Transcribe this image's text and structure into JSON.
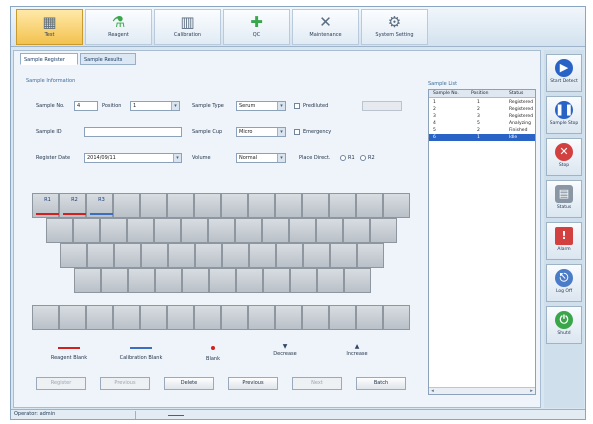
{
  "toolbar": {
    "items": [
      {
        "label": "Test",
        "icon": "test-icon",
        "active": true
      },
      {
        "label": "Reagent",
        "icon": "reagent-icon",
        "active": false
      },
      {
        "label": "Calibration",
        "icon": "calibration-icon",
        "active": false
      },
      {
        "label": "QC",
        "icon": "qc-icon",
        "active": false
      },
      {
        "label": "Maintenance",
        "icon": "maintenance-icon",
        "active": false
      },
      {
        "label": "System Setting",
        "icon": "system-setting-icon",
        "active": false
      }
    ]
  },
  "tabs": [
    {
      "label": "Sample Register",
      "active": true
    },
    {
      "label": "Sample Results",
      "active": false
    }
  ],
  "form": {
    "section_title": "Sample Information",
    "sample_no_label": "Sample No.",
    "sample_no_value": "4",
    "position_label": "Position",
    "position_value": "1",
    "sample_type_label": "Sample Type",
    "sample_type_value": "Serum",
    "prediluted_label": "Prediluted",
    "sample_id_label": "Sample ID",
    "sample_id_value": "",
    "sample_cup_label": "Sample Cup",
    "sample_cup_value": "Micro",
    "emergency_label": "Emergency",
    "register_date_label": "Register Date",
    "register_date_value": "2014/09/11",
    "volume_label": "Volume",
    "volume_value": "Normal",
    "place_direction_label": "Place Direct.",
    "place_direction_opt1": "R1",
    "place_direction_opt2": "R2"
  },
  "sample_list": {
    "title": "Sample List",
    "columns": [
      "Sample No.",
      "Position",
      "Status"
    ],
    "rows": [
      {
        "no": "1",
        "pos": "1",
        "status": "Registered",
        "selected": false
      },
      {
        "no": "2",
        "pos": "2",
        "status": "Registered",
        "selected": false
      },
      {
        "no": "3",
        "pos": "3",
        "status": "Registered",
        "selected": false
      },
      {
        "no": "4",
        "pos": "5",
        "status": "Analyzing",
        "selected": false
      },
      {
        "no": "5",
        "pos": "2",
        "status": "Finished",
        "selected": false
      },
      {
        "no": "6",
        "pos": "1",
        "status": "Idle",
        "selected": true
      }
    ]
  },
  "tray": {
    "labels": [
      {
        "text": "R1",
        "bar_color": "#d02020"
      },
      {
        "text": "R2",
        "bar_color": "#d02020"
      },
      {
        "text": "R3",
        "bar_color": "#3a6fc0"
      }
    ]
  },
  "legend": [
    {
      "label": "Reagent Blank",
      "mark": "line",
      "color": "#d02020"
    },
    {
      "label": "Calibration Blank",
      "mark": "line",
      "color": "#3a6fc0"
    },
    {
      "label": "Blank",
      "mark": "dot",
      "color": "#d02020"
    },
    {
      "label": "Decrease",
      "mark": "down",
      "color": "#334466"
    },
    {
      "label": "Increase",
      "mark": "up",
      "color": "#334466"
    }
  ],
  "buttons": [
    {
      "label": "Register",
      "enabled": false
    },
    {
      "label": "Previous",
      "enabled": false
    },
    {
      "label": "Delete",
      "enabled": true
    },
    {
      "label": "Previous",
      "enabled": true
    },
    {
      "label": "Next",
      "enabled": false
    },
    {
      "label": "Batch",
      "enabled": true
    }
  ],
  "side_buttons": [
    {
      "label": "Start Detect",
      "icon": "play-icon",
      "color": "#2a63c6",
      "glyph": "▶"
    },
    {
      "label": "Sample Stop",
      "icon": "pause-icon",
      "color": "#2a63c6",
      "glyph": "⏸"
    },
    {
      "label": "Stop",
      "icon": "stop-icon",
      "color": "#d24040",
      "glyph": "✕"
    },
    {
      "label": "Status",
      "icon": "status-icon",
      "color": "#8a96a4",
      "glyph": "▤"
    },
    {
      "label": "Alarm",
      "icon": "alarm-icon",
      "color": "#d24040",
      "glyph": "!"
    },
    {
      "label": "Log Off",
      "icon": "logoff-icon",
      "color": "#4a7cc8",
      "glyph": "⎋"
    },
    {
      "label": "Shutd",
      "icon": "shutdown-icon",
      "color": "#3aa64a",
      "glyph": "⏻"
    }
  ],
  "status": {
    "operator": "Operator: admin"
  }
}
